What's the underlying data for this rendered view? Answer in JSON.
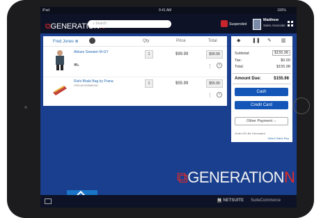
{
  "status": {
    "device": "iPad",
    "time": "9:41 AM",
    "battery": "100%"
  },
  "header": {
    "logo_text": "GENERATION",
    "logo_accent": "N",
    "logo_mark": "⧉",
    "search_placeholder": "Search",
    "suspended_label": "Suspended",
    "user_name": "Matthew",
    "user_role": "Sales Associate"
  },
  "cart": {
    "customer": "Fred Jones",
    "columns": [
      "Qty",
      "Price",
      "Total"
    ],
    "items": [
      {
        "name": "Ablaze Sweater-M-GY",
        "id": "",
        "qty": "1",
        "price": "$99.99",
        "total": "$99.99"
      },
      {
        "name": "Rishi Bhaki Bag by Prana",
        "id": "ITEM #912345681944",
        "qty": "1",
        "price": "$55.99",
        "total": "$55.99"
      }
    ]
  },
  "summary": {
    "subtotal_label": "Subtotal:",
    "subtotal": "$155.98",
    "tax_label": "Tax:",
    "tax": "$0.00",
    "total_label": "Total:",
    "total": "$155.98",
    "due_label": "Amount Due:",
    "due": "$155.98",
    "cash": "Cash",
    "card": "Credit Card",
    "other": "Other Payment ⌵",
    "order_note": "Order #To Be Generated",
    "sales_rep": "Select Sales Rep"
  },
  "footer": {
    "netsuite": "NETSUITE",
    "suitecommerce": "SuiteCommerce",
    "big_logo": "GENERATION",
    "big_accent": "N"
  },
  "colors": {
    "accent": "#e52b25",
    "primary": "#1456b8",
    "background": "#1a3f8e"
  }
}
